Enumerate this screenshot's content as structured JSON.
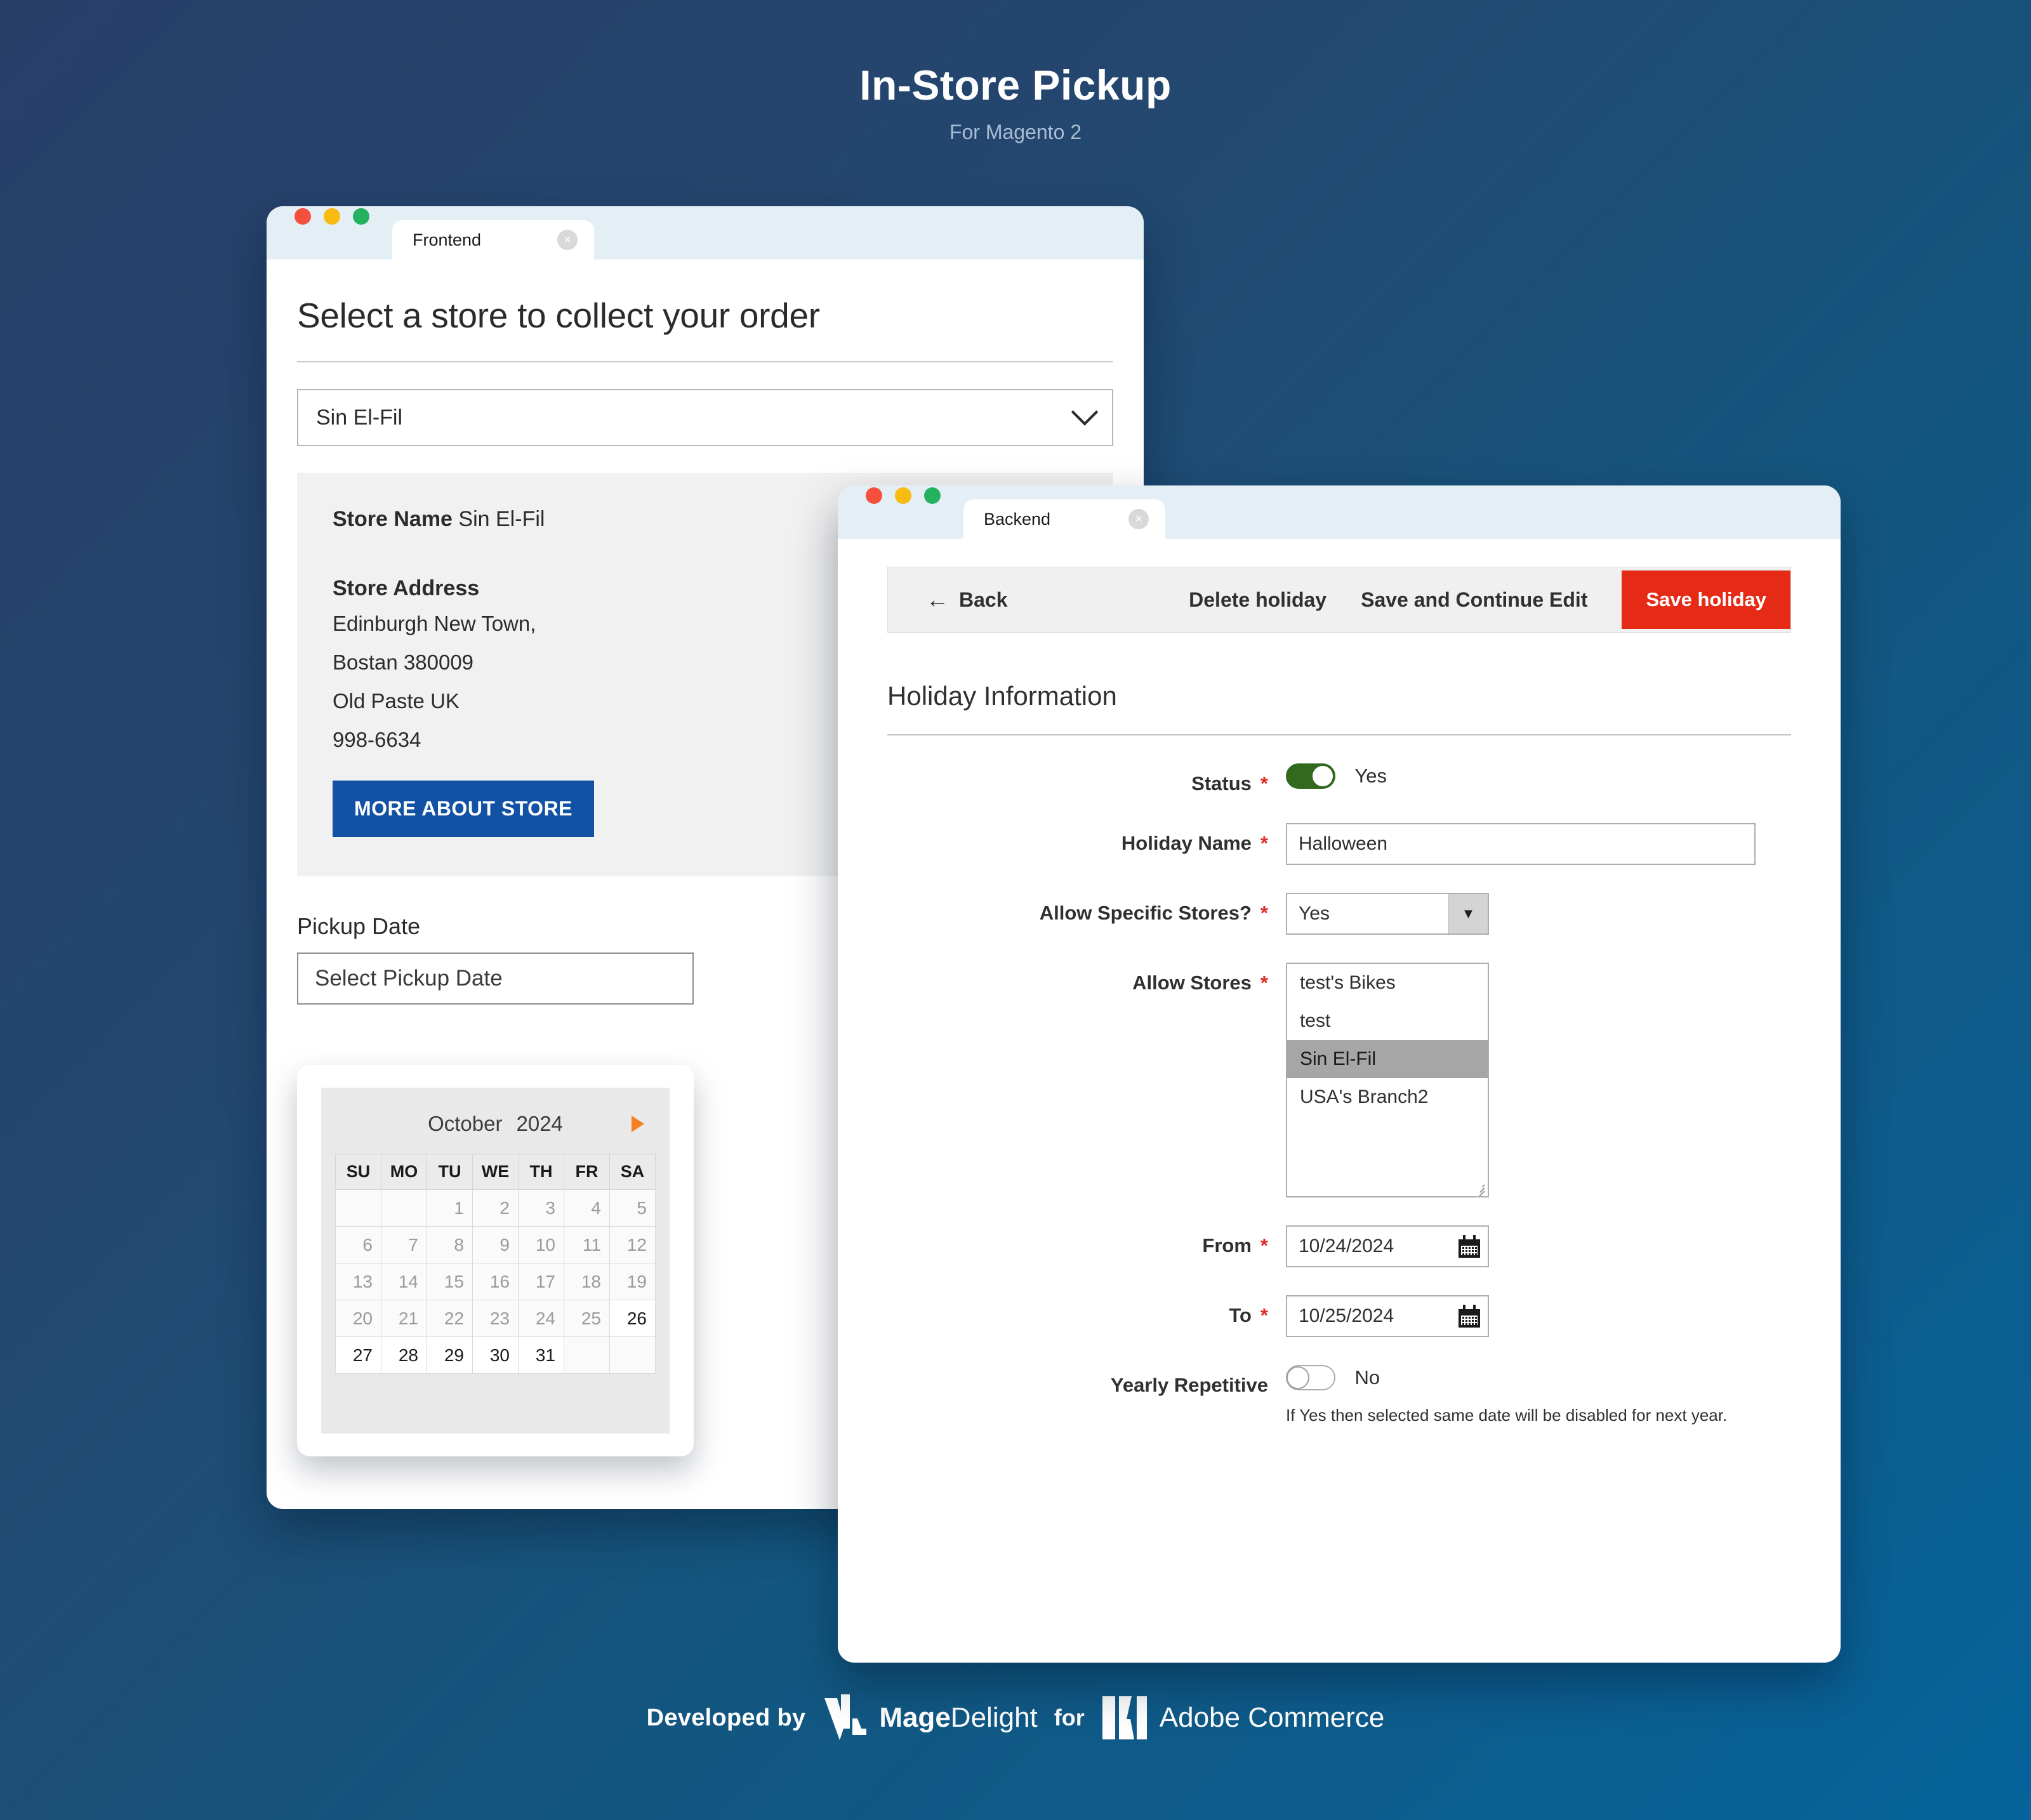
{
  "header": {
    "title": "In-Store Pickup",
    "subtitle": "For Magento 2"
  },
  "frontend": {
    "tab_label": "Frontend",
    "close_icon": "×",
    "heading": "Select a store to collect your order",
    "store_select_value": "Sin El-Fil",
    "store_name_label": "Store Name",
    "store_name_value": "Sin El-Fil",
    "store_address_label": "Store Address",
    "address_lines": [
      "Edinburgh New Town,",
      "Bostan 380009",
      "Old Paste UK",
      "998-6634"
    ],
    "more_button": "MORE ABOUT STORE",
    "pickup_date_label": "Pickup Date",
    "pickup_date_placeholder": "Select Pickup Date",
    "pickup_date_value": ""
  },
  "calendar": {
    "month": "October",
    "year": "2024",
    "next_icon": "next-arrow",
    "weekdays": [
      "SU",
      "MO",
      "TU",
      "WE",
      "TH",
      "FR",
      "SA"
    ],
    "weeks": [
      [
        {
          "d": "",
          "s": "empty"
        },
        {
          "d": "",
          "s": "empty"
        },
        {
          "d": "1",
          "s": "disabled"
        },
        {
          "d": "2",
          "s": "disabled"
        },
        {
          "d": "3",
          "s": "disabled"
        },
        {
          "d": "4",
          "s": "disabled"
        },
        {
          "d": "5",
          "s": "disabled"
        }
      ],
      [
        {
          "d": "6",
          "s": "disabled"
        },
        {
          "d": "7",
          "s": "disabled"
        },
        {
          "d": "8",
          "s": "disabled"
        },
        {
          "d": "9",
          "s": "disabled"
        },
        {
          "d": "10",
          "s": "disabled"
        },
        {
          "d": "11",
          "s": "disabled"
        },
        {
          "d": "12",
          "s": "disabled"
        }
      ],
      [
        {
          "d": "13",
          "s": "disabled"
        },
        {
          "d": "14",
          "s": "disabled"
        },
        {
          "d": "15",
          "s": "disabled"
        },
        {
          "d": "16",
          "s": "disabled"
        },
        {
          "d": "17",
          "s": "disabled"
        },
        {
          "d": "18",
          "s": "disabled"
        },
        {
          "d": "19",
          "s": "disabled"
        }
      ],
      [
        {
          "d": "20",
          "s": "disabled"
        },
        {
          "d": "21",
          "s": "disabled"
        },
        {
          "d": "22",
          "s": "disabled"
        },
        {
          "d": "23",
          "s": "disabled"
        },
        {
          "d": "24",
          "s": "disabled"
        },
        {
          "d": "25",
          "s": "disabled"
        },
        {
          "d": "26",
          "s": "active"
        }
      ],
      [
        {
          "d": "27",
          "s": "active"
        },
        {
          "d": "28",
          "s": "active"
        },
        {
          "d": "29",
          "s": "active"
        },
        {
          "d": "30",
          "s": "active"
        },
        {
          "d": "31",
          "s": "active"
        },
        {
          "d": "",
          "s": "empty"
        },
        {
          "d": "",
          "s": "empty"
        }
      ]
    ]
  },
  "backend": {
    "tab_label": "Backend",
    "close_icon": "×",
    "toolbar": {
      "back_label": "Back",
      "back_icon": "←",
      "delete_label": "Delete holiday",
      "save_continue_label": "Save and Continue Edit",
      "save_label": "Save holiday",
      "save_color": "#e52b16"
    },
    "section_title": "Holiday Information",
    "fields": {
      "status_label": "Status",
      "status_value": "Yes",
      "status_on": true,
      "holiday_name_label": "Holiday Name",
      "holiday_name_value": "Halloween",
      "allow_specific_label": "Allow Specific Stores?",
      "allow_specific_value": "Yes",
      "allow_stores_label": "Allow Stores",
      "allow_stores_options": [
        {
          "label": "test's Bikes",
          "selected": false
        },
        {
          "label": "test",
          "selected": false
        },
        {
          "label": "Sin El-Fil",
          "selected": true
        },
        {
          "label": "USA's Branch2",
          "selected": false
        }
      ],
      "from_label": "From",
      "from_value": "10/24/2024",
      "to_label": "To",
      "to_value": "10/25/2024",
      "yearly_label": "Yearly Repetitive",
      "yearly_value": "No",
      "yearly_on": false,
      "helper_text": "If Yes then selected same date will be disabled for next year.",
      "required_marker": "*"
    }
  },
  "footer": {
    "developed_by": "Developed by",
    "magedelight_bold": "Mage",
    "magedelight_light": "Delight",
    "for": "for",
    "adobe_name": "Adobe Commerce"
  }
}
